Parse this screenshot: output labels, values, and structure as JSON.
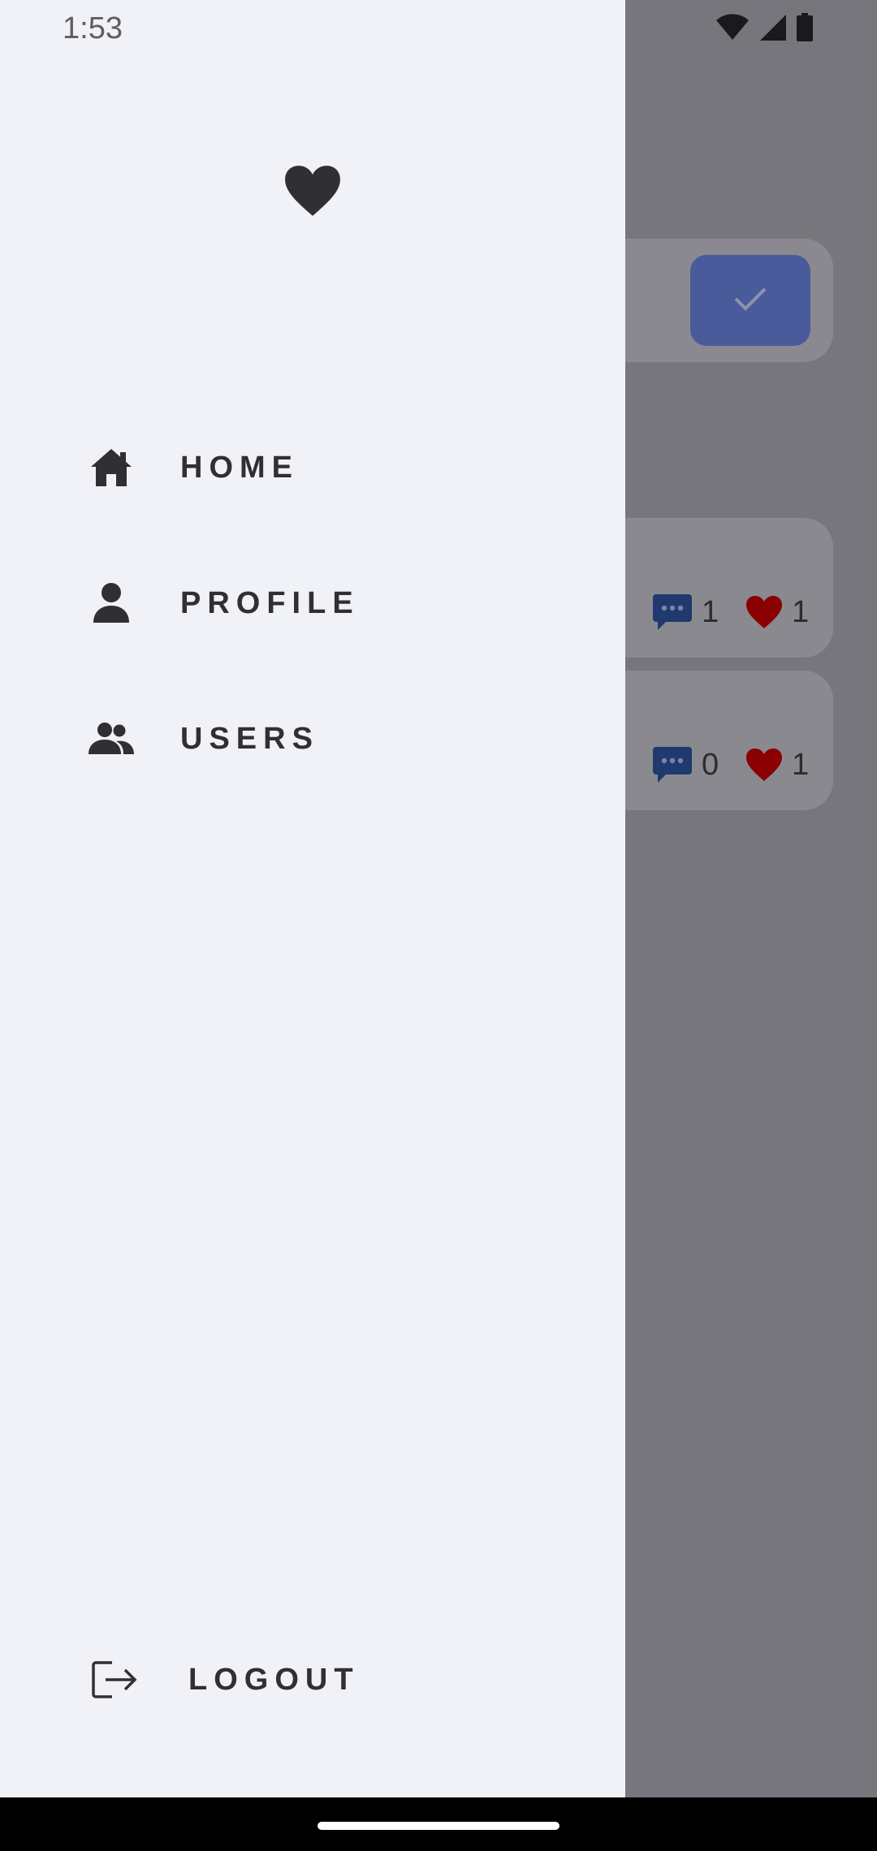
{
  "status_bar": {
    "time": "1:53",
    "icons": [
      "wifi-icon",
      "cellular-signal-icon",
      "battery-icon"
    ]
  },
  "drawer": {
    "logo_icon": "heart-icon",
    "items": [
      {
        "label": "HOME",
        "icon": "home-icon"
      },
      {
        "label": "PROFILE",
        "icon": "person-icon"
      },
      {
        "label": "USERS",
        "icon": "group-icon"
      }
    ],
    "logout": {
      "label": "LOGOUT",
      "icon": "logout-icon"
    }
  },
  "background": {
    "confirm_button_icon": "check-icon",
    "posts": [
      {
        "comments": "1",
        "likes": "1"
      },
      {
        "comments": "0",
        "likes": "1"
      }
    ]
  },
  "colors": {
    "drawer_bg": "#f1f2f7",
    "scrim": "#77767c",
    "accent_blue": "#4a5b9c",
    "comment_blue": "#1f3a6e",
    "heart_red": "#8b0000",
    "icon_dark": "#303034"
  }
}
